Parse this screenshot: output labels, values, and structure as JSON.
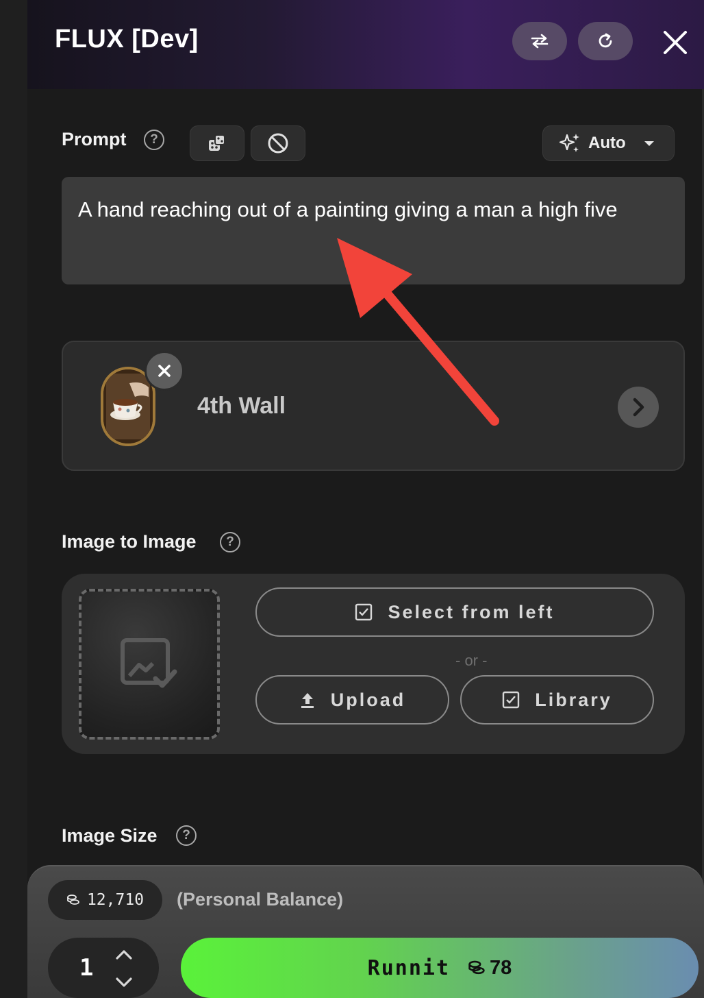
{
  "header": {
    "title": "FLUX [Dev]"
  },
  "prompt": {
    "label": "Prompt",
    "text": "A hand reaching out of a painting giving a man a high five",
    "mode": "Auto"
  },
  "style": {
    "name": "4th Wall"
  },
  "image_to_image": {
    "label": "Image to Image",
    "select_label": "Select from left",
    "or_label": "- or -",
    "upload_label": "Upload",
    "library_label": "Library"
  },
  "image_size": {
    "label": "Image Size"
  },
  "footer": {
    "balance": "12,710",
    "balance_label": "(Personal Balance)",
    "quantity": "1",
    "run_label": "Runnit",
    "run_cost": "78"
  },
  "colors": {
    "annotation_arrow": "#f2443a",
    "run_gradient_start": "#5af23a",
    "run_gradient_end": "#6a8db0",
    "header_purple": "#3a1f5c"
  }
}
